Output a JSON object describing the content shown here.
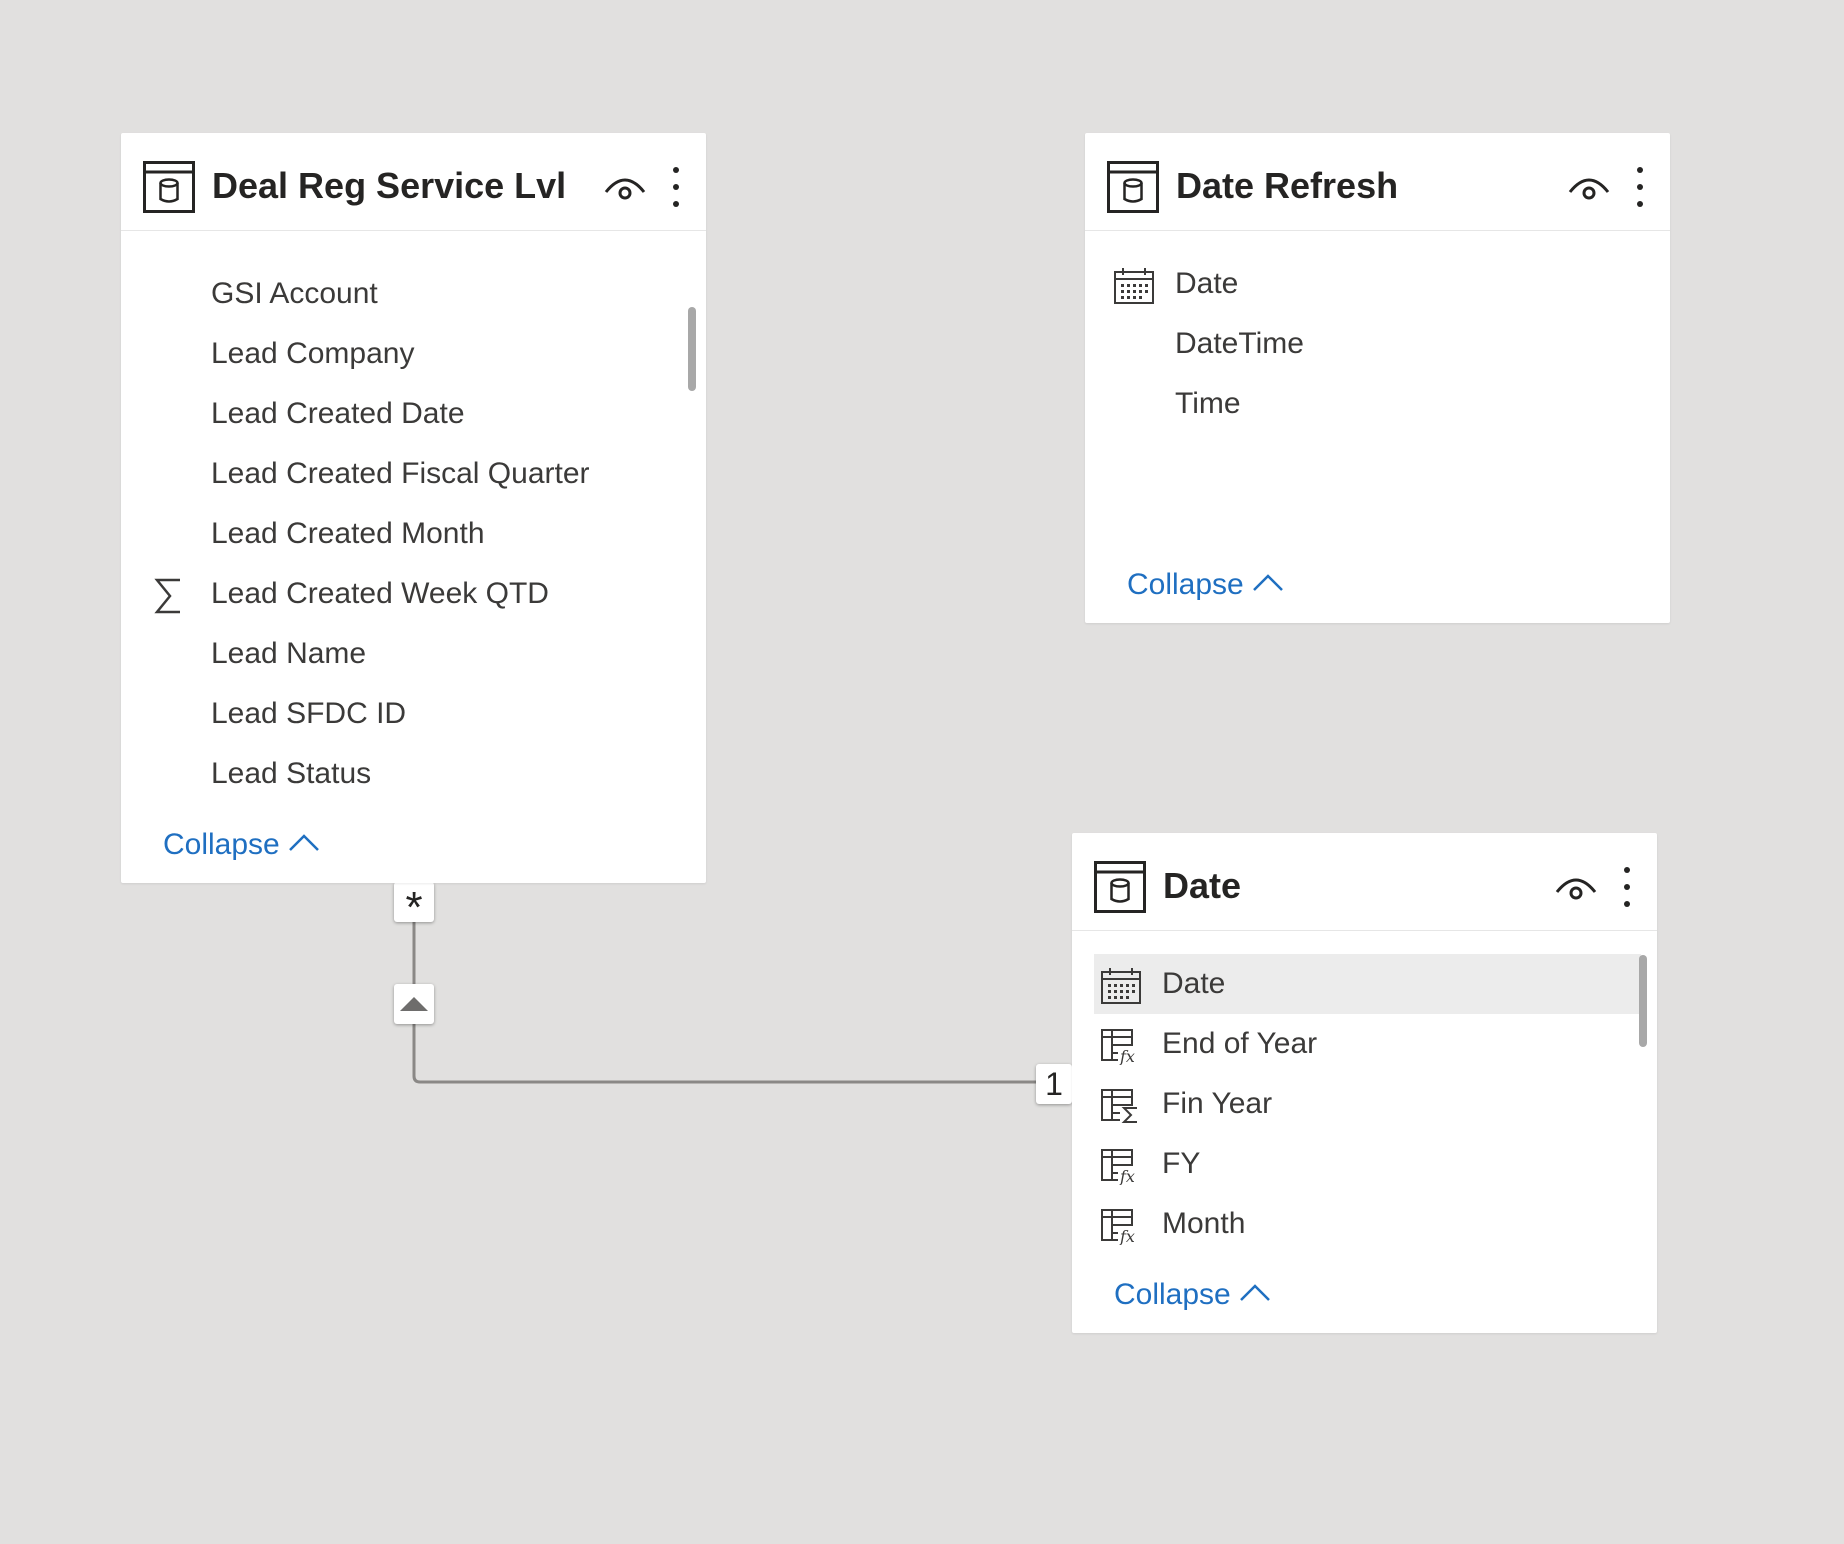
{
  "tables": [
    {
      "title": "Deal Reg Service Lvl",
      "fields": [
        {
          "label": "GSI Account",
          "icon": ""
        },
        {
          "label": "Lead Company",
          "icon": ""
        },
        {
          "label": "Lead Created Date",
          "icon": ""
        },
        {
          "label": "Lead Created Fiscal Quarter",
          "icon": ""
        },
        {
          "label": "Lead Created Month",
          "icon": ""
        },
        {
          "label": "Lead Created Week QTD",
          "icon": "sigma-icon"
        },
        {
          "label": "Lead Name",
          "icon": ""
        },
        {
          "label": "Lead SFDC ID",
          "icon": ""
        },
        {
          "label": "Lead Status",
          "icon": ""
        }
      ],
      "collapse_label": "Collapse"
    },
    {
      "title": "Date Refresh",
      "fields": [
        {
          "label": "Date",
          "icon": "calendar-icon"
        },
        {
          "label": "DateTime",
          "icon": ""
        },
        {
          "label": "Time",
          "icon": ""
        }
      ],
      "collapse_label": "Collapse"
    },
    {
      "title": "Date",
      "fields": [
        {
          "label": "Date",
          "icon": "calendar-icon",
          "selected": true
        },
        {
          "label": "End of Year",
          "icon": "calculated-column-icon"
        },
        {
          "label": "Fin Year",
          "icon": "calculated-sum-column-icon"
        },
        {
          "label": "FY",
          "icon": "calculated-column-icon"
        },
        {
          "label": "Month",
          "icon": "calculated-column-icon"
        }
      ],
      "collapse_label": "Collapse"
    }
  ],
  "relationship": {
    "many_side_label": "*",
    "one_side_label": "1",
    "direction": "single"
  },
  "colors": {
    "canvas": "#e1e0df",
    "link": "#1f6fc1",
    "text": "#3b3a39",
    "title": "#252423",
    "selected_row": "#ececec"
  }
}
